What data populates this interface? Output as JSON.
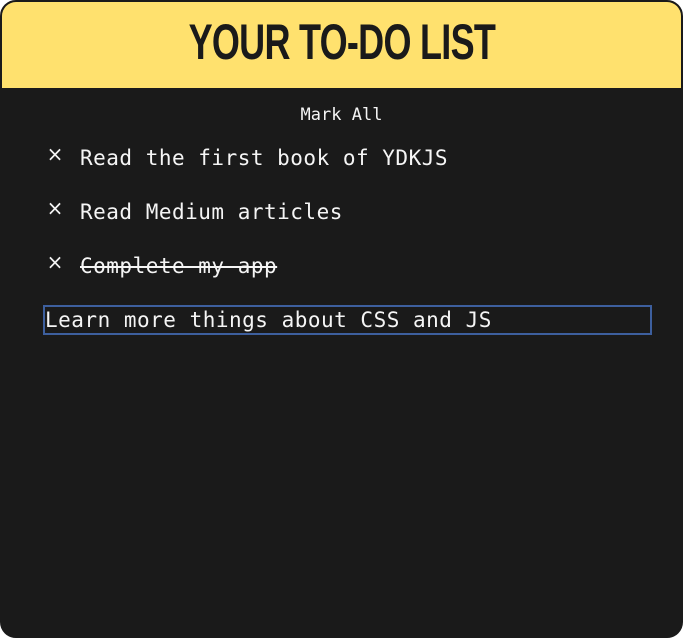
{
  "header": {
    "title": "YOUR TO-DO LIST"
  },
  "controls": {
    "mark_all_label": "Mark All"
  },
  "todos": [
    {
      "text": "Read the first book of YDKJS",
      "completed": false,
      "delete_icon": "close-icon"
    },
    {
      "text": "Read Medium articles",
      "completed": false,
      "delete_icon": "close-icon"
    },
    {
      "text": "Complete my app",
      "completed": true,
      "delete_icon": "close-icon"
    }
  ],
  "new_todo_input": {
    "value": "Learn more things about CSS and JS"
  },
  "colors": {
    "header_background": "#ffe16e",
    "body_background": "#1a1a1a",
    "text": "#f5f5f5",
    "input_border": "#3d5f9e"
  },
  "icons": {
    "delete": "×"
  }
}
